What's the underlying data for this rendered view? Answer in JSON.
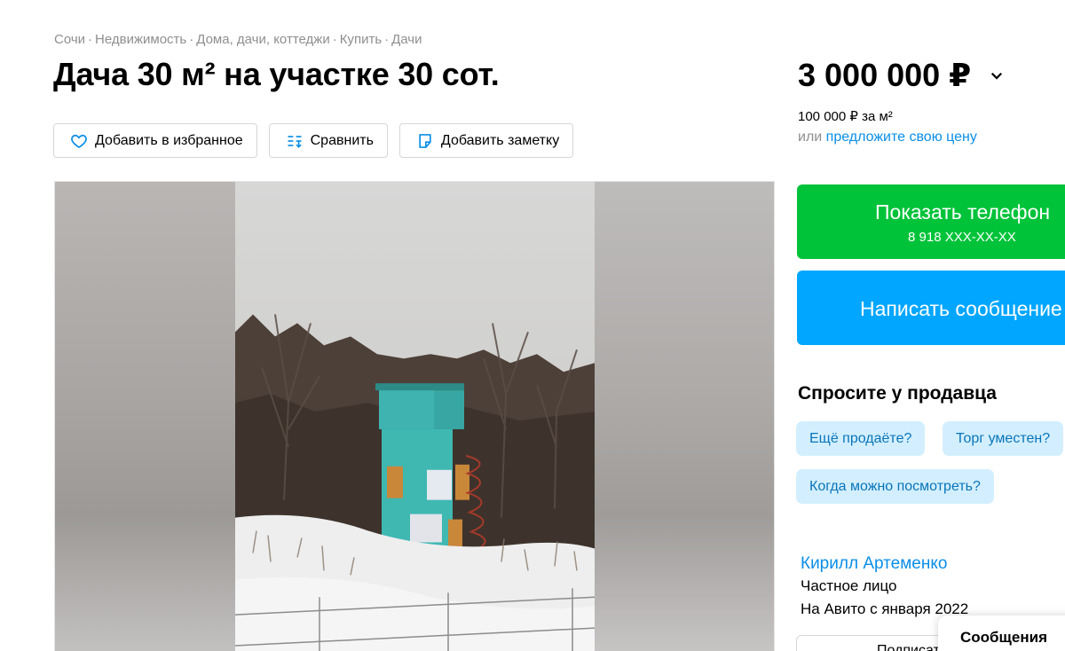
{
  "breadcrumb": {
    "items": [
      "Сочи",
      "Недвижимость",
      "Дома, дачи, коттеджи",
      "Купить",
      "Дачи"
    ],
    "separator": "·"
  },
  "title": "Дача 30 м² на участке 30 сот.",
  "actions": {
    "favorite_label": "Добавить в избранное",
    "compare_label": "Сравнить",
    "note_label": "Добавить заметку"
  },
  "gallery": {
    "photo_icon": "dacha-photo"
  },
  "price": {
    "value": "3 000 000 ₽",
    "per_m2": "100 000 ₽ за м²",
    "offer_prefix": "или ",
    "offer_link": "предложите свою цену"
  },
  "contact": {
    "phone_button_label": "Показать телефон",
    "phone_masked": "8 918 XXX-XX-XX",
    "message_button_label": "Написать сообщение"
  },
  "ask_seller": {
    "title": "Спросите у продавца",
    "questions": [
      "Ещё продаёте?",
      "Торг уместен?",
      "Когда можно посмотреть?"
    ]
  },
  "seller": {
    "name": "Кирилл Артеменко",
    "type": "Частное лицо",
    "since": "На Авито с января 2022",
    "subscribe_label": "Подписаться"
  },
  "messages_popup": {
    "label": "Сообщения"
  },
  "colors": {
    "phone_button": "#01c339",
    "message_button": "#00a6ff",
    "link": "#0a8ee6",
    "chip_bg": "#d3efff",
    "chip_text": "#0875ba",
    "muted": "#8f8f8f"
  }
}
